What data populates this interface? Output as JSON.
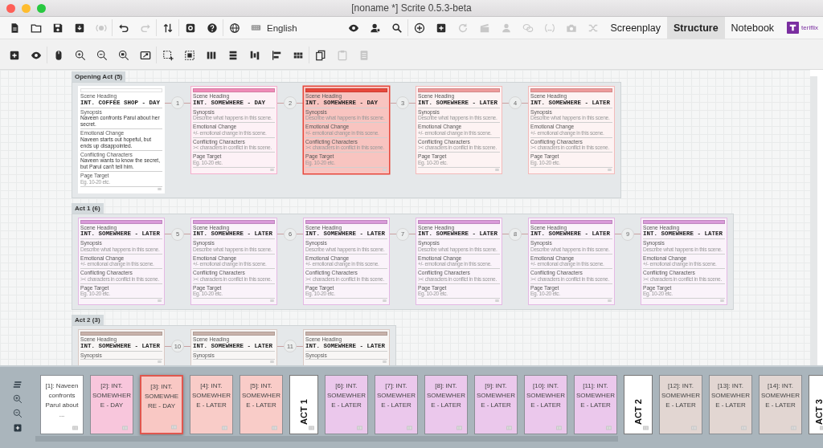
{
  "window": {
    "title": "[noname *] Scrite 0.5.3-beta"
  },
  "toolbar": {
    "buttons": [
      {
        "disabled": false
      },
      {
        "disabled": false
      },
      {
        "disabled": false
      },
      {
        "disabled": false
      },
      {
        "disabled": true
      },
      {
        "disabled": false
      },
      {
        "disabled": true
      },
      {
        "disabled": false
      },
      {
        "disabled": false
      },
      {
        "disabled": false
      },
      {
        "disabled": false
      },
      {
        "disabled": false
      },
      {
        "disabled": false
      },
      {
        "disabled": false
      },
      {
        "disabled": false
      },
      {
        "disabled": false
      },
      {
        "disabled": true
      },
      {
        "disabled": true
      },
      {
        "disabled": true
      },
      {
        "disabled": true
      },
      {
        "disabled": true
      },
      {
        "disabled": true
      },
      {
        "disabled": true
      }
    ],
    "language": "English",
    "tabs": [
      {
        "label": "Screenplay",
        "selected": false
      },
      {
        "label": "Structure",
        "selected": true
      },
      {
        "label": "Notebook",
        "selected": false
      }
    ],
    "brand": "teriflix"
  },
  "structure_toolbar": {
    "buttons": [
      {
        "disabled": false
      },
      {
        "disabled": false
      },
      {
        "disabled": false
      },
      {
        "disabled": false
      },
      {
        "disabled": false
      },
      {
        "disabled": false
      },
      {
        "disabled": false
      },
      {
        "disabled": false
      },
      {
        "disabled": false
      },
      {
        "disabled": false
      },
      {
        "disabled": false
      },
      {
        "disabled": false
      },
      {
        "disabled": false
      },
      {
        "disabled": false
      },
      {
        "disabled": false
      },
      {
        "disabled": true
      },
      {
        "disabled": true
      }
    ]
  },
  "canvas": {
    "acts": [
      {
        "title": "Opening Act (5)",
        "links": [
          "1",
          "2",
          "3",
          "4"
        ],
        "scenes": [
          {
            "color": "#ffffff",
            "selected": false,
            "heading": {
              "label": "Scene Heading",
              "value": "INT. COFFEE SHOP - DAY"
            },
            "fields": [
              {
                "label": "Synopsis",
                "value": "Naveen confronts Parul about her secret."
              },
              {
                "label": "Emotional Change",
                "value": "Naveen starts out hopeful, but ends up disappointed."
              },
              {
                "label": "Conflicting Characters",
                "value": "Naveen wants to know the secret, but Parul can't tell him."
              },
              {
                "label": "Page Target",
                "placeholder": "Eg. 10-20 etc."
              }
            ]
          },
          {
            "color": "#f08cb8",
            "selected": false,
            "heading": {
              "label": "Scene Heading",
              "value": "INT. SOMEWHERE - DAY"
            },
            "fields": [
              {
                "label": "Synopsis",
                "placeholder": "Describe what happens in this scene."
              },
              {
                "label": "Emotional Change",
                "placeholder": "+/- emotional change in this scene."
              },
              {
                "label": "Conflicting Characters",
                "placeholder": ">< characters in conflict in this scene."
              },
              {
                "label": "Page Target",
                "placeholder": "Eg. 10-20 etc."
              }
            ]
          },
          {
            "color": "#e8473b",
            "selected": true,
            "heading": {
              "label": "Scene Heading",
              "value": "INT. SOMEWHERE - DAY"
            },
            "fields": [
              {
                "label": "Synopsis",
                "placeholder": "Describe what happens in this scene."
              },
              {
                "label": "Emotional Change",
                "placeholder": "+/- emotional change in this scene."
              },
              {
                "label": "Conflicting Characters",
                "placeholder": ">< characters in conflict in this scene."
              },
              {
                "label": "Page Target",
                "placeholder": "Eg. 10-20 etc."
              }
            ]
          },
          {
            "color": "#ee9c9c",
            "selected": false,
            "heading": {
              "label": "Scene Heading",
              "value": "INT. SOMEWHERE - LATER"
            },
            "fields": [
              {
                "label": "Synopsis",
                "placeholder": "Describe what happens in this scene."
              },
              {
                "label": "Emotional Change",
                "placeholder": "+/- emotional change in this scene."
              },
              {
                "label": "Conflicting Characters",
                "placeholder": ">< characters in conflict in this scene."
              },
              {
                "label": "Page Target",
                "placeholder": "Eg. 10-20 etc."
              }
            ]
          },
          {
            "color": "#ee9c9c",
            "selected": false,
            "heading": {
              "label": "Scene Heading",
              "value": "INT. SOMEWHERE - LATER"
            },
            "fields": [
              {
                "label": "Synopsis",
                "placeholder": "Describe what happens in this scene."
              },
              {
                "label": "Emotional Change",
                "placeholder": "+/- emotional change in this scene."
              },
              {
                "label": "Conflicting Characters",
                "placeholder": ">< characters in conflict in this scene."
              },
              {
                "label": "Page Target",
                "placeholder": "Eg. 10-20 etc."
              }
            ]
          }
        ]
      },
      {
        "title": "Act 1 (6)",
        "links": [
          "5",
          "6",
          "7",
          "8",
          "9"
        ],
        "scenes": [
          {
            "color": "#d99ad9",
            "selected": false,
            "heading": {
              "label": "Scene Heading",
              "value": "INT. SOMEWHERE - LATER"
            },
            "fields": [
              {
                "label": "Synopsis",
                "placeholder": "Describe what happens in this scene."
              },
              {
                "label": "Emotional Change",
                "placeholder": "+/- emotional change in this scene."
              },
              {
                "label": "Conflicting Characters",
                "placeholder": ">< characters in conflict in this scene."
              },
              {
                "label": "Page Target",
                "placeholder": "Eg. 10-20 etc."
              }
            ]
          },
          {
            "color": "#d99ad9",
            "selected": false,
            "heading": {
              "label": "Scene Heading",
              "value": "INT. SOMEWHERE - LATER"
            },
            "fields": [
              {
                "label": "Synopsis",
                "placeholder": "Describe what happens in this scene."
              },
              {
                "label": "Emotional Change",
                "placeholder": "+/- emotional change in this scene."
              },
              {
                "label": "Conflicting Characters",
                "placeholder": ">< characters in conflict in this scene."
              },
              {
                "label": "Page Target",
                "placeholder": "Eg. 10-20 etc."
              }
            ]
          },
          {
            "color": "#d99ad9",
            "selected": false,
            "heading": {
              "label": "Scene Heading",
              "value": "INT. SOMEWHERE - LATER"
            },
            "fields": [
              {
                "label": "Synopsis",
                "placeholder": "Describe what happens in this scene."
              },
              {
                "label": "Emotional Change",
                "placeholder": "+/- emotional change in this scene."
              },
              {
                "label": "Conflicting Characters",
                "placeholder": ">< characters in conflict in this scene."
              },
              {
                "label": "Page Target",
                "placeholder": "Eg. 10-20 etc."
              }
            ]
          },
          {
            "color": "#d99ad9",
            "selected": false,
            "heading": {
              "label": "Scene Heading",
              "value": "INT. SOMEWHERE - LATER"
            },
            "fields": [
              {
                "label": "Synopsis",
                "placeholder": "Describe what happens in this scene."
              },
              {
                "label": "Emotional Change",
                "placeholder": "+/- emotional change in this scene."
              },
              {
                "label": "Conflicting Characters",
                "placeholder": ">< characters in conflict in this scene."
              },
              {
                "label": "Page Target",
                "placeholder": "Eg. 10-20 etc."
              }
            ]
          },
          {
            "color": "#d99ad9",
            "selected": false,
            "heading": {
              "label": "Scene Heading",
              "value": "INT. SOMEWHERE - LATER"
            },
            "fields": [
              {
                "label": "Synopsis",
                "placeholder": "Describe what happens in this scene."
              },
              {
                "label": "Emotional Change",
                "placeholder": "+/- emotional change in this scene."
              },
              {
                "label": "Conflicting Characters",
                "placeholder": ">< characters in conflict in this scene."
              },
              {
                "label": "Page Target",
                "placeholder": "Eg. 10-20 etc."
              }
            ]
          },
          {
            "color": "#d99ad9",
            "selected": false,
            "heading": {
              "label": "Scene Heading",
              "value": "INT. SOMEWHERE - LATER"
            },
            "fields": [
              {
                "label": "Synopsis",
                "placeholder": "Describe what happens in this scene."
              },
              {
                "label": "Emotional Change",
                "placeholder": "+/- emotional change in this scene."
              },
              {
                "label": "Conflicting Characters",
                "placeholder": ">< characters in conflict in this scene."
              },
              {
                "label": "Page Target",
                "placeholder": "Eg. 10-20 etc."
              }
            ]
          }
        ]
      },
      {
        "title": "Act 2 (3)",
        "links": [
          "10",
          "11"
        ],
        "scenes": [
          {
            "color": "#c8b2aa",
            "selected": false,
            "heading": {
              "label": "Scene Heading",
              "value": "INT. SOMEWHERE - LATER"
            },
            "fields": [
              {
                "label": "Synopsis"
              }
            ]
          },
          {
            "color": "#c8b2aa",
            "selected": false,
            "heading": {
              "label": "Scene Heading",
              "value": "INT. SOMEWHERE - LATER"
            },
            "fields": [
              {
                "label": "Synopsis"
              }
            ]
          },
          {
            "color": "#c8b2aa",
            "selected": false,
            "heading": {
              "label": "Scene Heading",
              "value": "INT. SOMEWHERE - LATER"
            },
            "fields": [
              {
                "label": "Synopsis"
              }
            ]
          }
        ]
      }
    ]
  },
  "timeline": {
    "items": [
      {
        "kind": "scene",
        "label": "[1]: Naveen confronts Parul about ...",
        "color": "#ffffff",
        "selected": false
      },
      {
        "kind": "scene",
        "label": "[2]: INT. SOMEWHERE - DAY",
        "color": "#f8c6dc",
        "selected": false
      },
      {
        "kind": "scene",
        "label": "[3]: INT. SOMEWHERE - DAY",
        "color": "#f9c8c4",
        "selected": true
      },
      {
        "kind": "scene",
        "label": "[4]: INT. SOMEWHERE - LATER",
        "color": "#f9ccc8",
        "selected": false
      },
      {
        "kind": "scene",
        "label": "[5]: INT. SOMEWHERE - LATER",
        "color": "#f9ccc8",
        "selected": false
      },
      {
        "kind": "act",
        "label": "ACT 1"
      },
      {
        "kind": "scene",
        "label": "[6]: INT. SOMEWHERE - LATER",
        "color": "#ebc8ec",
        "selected": false
      },
      {
        "kind": "scene",
        "label": "[7]: INT. SOMEWHERE - LATER",
        "color": "#ebc8ec",
        "selected": false
      },
      {
        "kind": "scene",
        "label": "[8]: INT. SOMEWHERE - LATER",
        "color": "#ebc8ec",
        "selected": false
      },
      {
        "kind": "scene",
        "label": "[9]: INT. SOMEWHERE - LATER",
        "color": "#ebc8ec",
        "selected": false
      },
      {
        "kind": "scene",
        "label": "[10]: INT. SOMEWHERE - LATER",
        "color": "#ebc8ec",
        "selected": false
      },
      {
        "kind": "scene",
        "label": "[11]: INT. SOMEWHERE - LATER",
        "color": "#ebc8ec",
        "selected": false
      },
      {
        "kind": "act",
        "label": "ACT 2"
      },
      {
        "kind": "scene",
        "label": "[12]: INT. SOMEWHERE - LATER",
        "color": "#e2d6d2",
        "selected": false
      },
      {
        "kind": "scene",
        "label": "[13]: INT. SOMEWHERE - LATER",
        "color": "#e2d6d2",
        "selected": false
      },
      {
        "kind": "scene",
        "label": "[14]: INT. SOMEWHERE - LATER",
        "color": "#e2d6d2",
        "selected": false
      },
      {
        "kind": "act",
        "label": "ACT 3"
      }
    ]
  }
}
